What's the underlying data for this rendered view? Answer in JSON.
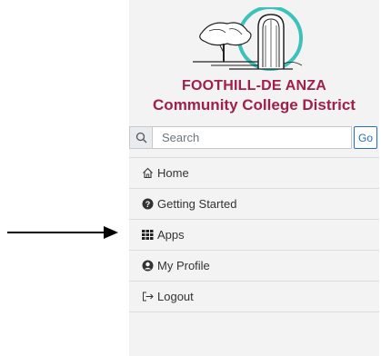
{
  "logo": {
    "line1": "FOOTHILL-DE ANZA",
    "line2": "Community College District",
    "color": "#a0204a",
    "ring_color": "#3cc2b8"
  },
  "search": {
    "placeholder": "Search",
    "go_label": "Go"
  },
  "menu": {
    "items": [
      {
        "label": "Home",
        "icon": "home-icon"
      },
      {
        "label": "Getting Started",
        "icon": "question-circle-icon"
      },
      {
        "label": "Apps",
        "icon": "grid-icon"
      },
      {
        "label": "My Profile",
        "icon": "user-circle-icon"
      },
      {
        "label": "Logout",
        "icon": "logout-icon"
      }
    ]
  },
  "annotation": {
    "points_to": "Apps",
    "icon": "right-arrow-icon"
  }
}
